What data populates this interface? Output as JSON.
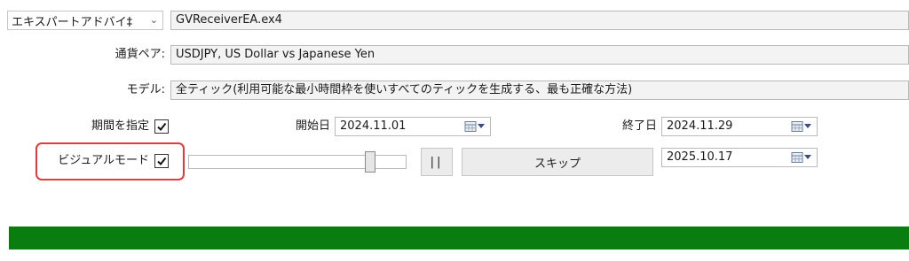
{
  "expert": {
    "dropdown_label": "エキスパートアドバイ‡",
    "file_value": "GVReceiverEA.ex4"
  },
  "symbol": {
    "label": "通貨ペア:",
    "value": "USDJPY, US Dollar vs Japanese Yen"
  },
  "model": {
    "label": "モデル:",
    "value": "全ティック(利用可能な最小時間枠を使いすべてのティックを生成する、最も正確な方法)"
  },
  "period": {
    "label": "期間を指定",
    "checked": true,
    "start_label": "開始日",
    "start_value": "2024.11.01",
    "end_label": "終了日",
    "end_value": "2024.11.29"
  },
  "visual": {
    "label": "ビジュアルモード",
    "checked": true,
    "speed_fraction": 0.85,
    "pause_label": "||",
    "skip_label": "スキップ",
    "skip_to_value": "2025.10.17"
  },
  "progress": {
    "fraction": 1.0,
    "color": "#0a7d10"
  },
  "colors": {
    "highlight": "#e23b3b",
    "progress": "#0a7d10"
  },
  "icons": {
    "calendar": "calendar-icon",
    "dropdown": "chevron-down-icon",
    "check": "check-icon"
  }
}
